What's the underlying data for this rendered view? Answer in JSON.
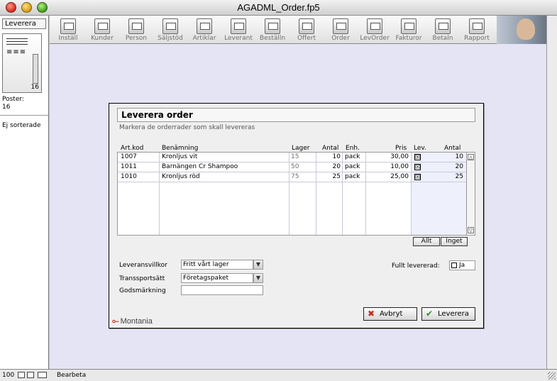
{
  "window": {
    "title": "AGADML_Order.fp5"
  },
  "sidebar": {
    "mode": "Leverera",
    "record_count": "16",
    "records_label": "Poster:",
    "records_value": "16",
    "sort_status": "Ej sorterade"
  },
  "toolbar": {
    "buttons": [
      {
        "label": "Inställ",
        "icon": "settings-icon"
      },
      {
        "label": "Kunder",
        "icon": "customers-icon"
      },
      {
        "label": "Person",
        "icon": "person-icon"
      },
      {
        "label": "Säljstöd",
        "icon": "sales-support-icon"
      },
      {
        "label": "Artiklar",
        "icon": "articles-icon"
      },
      {
        "label": "Leverant",
        "icon": "supplier-icon"
      },
      {
        "label": "Beställn",
        "icon": "purchase-order-icon"
      },
      {
        "label": "Offert",
        "icon": "quote-icon"
      },
      {
        "label": "Order",
        "icon": "order-icon"
      },
      {
        "label": "LevOrder",
        "icon": "delivery-order-icon"
      },
      {
        "label": "Fakturor",
        "icon": "invoice-icon"
      },
      {
        "label": "Betaln",
        "icon": "payment-icon"
      },
      {
        "label": "Rapport",
        "icon": "printer-icon"
      }
    ]
  },
  "dialog": {
    "title": "Leverera order",
    "subtitle": "Markera de orderrader som skall levereras",
    "columns": {
      "art_kod": "Art.kod",
      "benamning": "Benämning",
      "lager": "Lager",
      "antal": "Antal",
      "enh": "Enh.",
      "pris": "Pris",
      "lev": "Lev.",
      "lev_antal": "Antal"
    },
    "rows": [
      {
        "art_kod": "1007",
        "benamning": "Kronljus vit",
        "lager": "15",
        "antal": "10",
        "enh": "pack",
        "pris": "30,00",
        "lev": "☒",
        "lev_antal": "10"
      },
      {
        "art_kod": "1011",
        "benamning": "Barnängen Cr Shampoo",
        "lager": "50",
        "antal": "20",
        "enh": "pack",
        "pris": "10,00",
        "lev": "☒",
        "lev_antal": "20"
      },
      {
        "art_kod": "1010",
        "benamning": "Kronljus röd",
        "lager": "75",
        "antal": "25",
        "enh": "pack",
        "pris": "25,00",
        "lev": "☒",
        "lev_antal": "25"
      }
    ],
    "all_button": "Allt",
    "none_button": "Inget",
    "leveransvillkor_label": "Leveransvillkor",
    "leveransvillkor_value": "Fritt vårt lager",
    "transportsatt_label": "Transsportsätt",
    "transportsatt_value": "Företagspaket",
    "godsmarkning_label": "Godsmärkning",
    "godsmarkning_value": "",
    "fully_delivered_label": "Fullt levererad:",
    "fully_delivered_option": "Ja",
    "cancel_button": "Avbryt",
    "deliver_button": "Leverera",
    "logo_text": "Montania"
  },
  "statusbar": {
    "zoom": "100",
    "mode": "Bearbeta"
  },
  "colors": {
    "canvas": "#e4e4f5",
    "cancel_icon": "#cc2a1e",
    "ok_icon": "#2e8b2e"
  }
}
